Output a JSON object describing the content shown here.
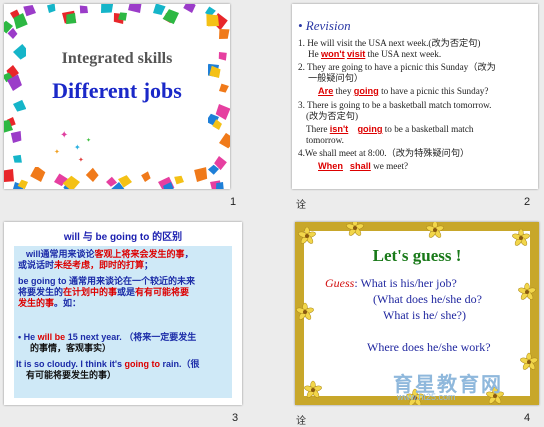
{
  "slide1": {
    "title": "Integrated skills",
    "subtitle": "Different jobs",
    "number": "1"
  },
  "slide2": {
    "heading": "• Revision",
    "l1": "1. He will visit the USA next week.(改为否定句)",
    "l2a": "He ",
    "l2b": "won't",
    "l2c": " ",
    "l2d": "visit",
    "l2e": " the USA next week.",
    "l3": "2. They are going to have a picnic this Sunday（改为",
    "l4": "一般疑问句）",
    "l5a": "Are",
    "l5b": " they ",
    "l5c": "going",
    "l5d": " to have a picnic this Sunday?",
    "l6": "3. There is going to be a basketball match tomorrow.",
    "l7": "(改为否定句)",
    "l8a": "There ",
    "l8b": "isn't",
    "l8c": "going",
    "l8d": " to be a basketball match",
    "l9": "tomorrow.",
    "l10": "4.We shall meet at 8:00.（改为特殊疑问句）",
    "l11a": "When",
    "l11b": "shall",
    "l11c": " we meet?",
    "number": "2",
    "note": "诠"
  },
  "slide3": {
    "heading": "will 与 be going to 的区别",
    "p1a": "will通常用来谈论",
    "p1b": "客观上将来会发生的事",
    "p1c": "，",
    "p1d": "或说话时",
    "p1e": "未经考虑，即时的打算",
    "p1f": "；",
    "p2a": "be going to 通常用来谈论在一个较近的未来",
    "p2b": "将要发生的",
    "p2c": "在计划中的事",
    "p2d": "或是",
    "p2e": "有有可能将要",
    "p2f": "发生的事",
    "p2g": "。如：",
    "ex1a": "• He ",
    "ex1b": "will be",
    "ex1c": " 15 next year. （将来一定要发生",
    "ex1d": "的事情，客观事实）",
    "ex2a": "It is so cloudy. I think it's ",
    "ex2b": "going to",
    "ex2c": " rain.（很",
    "ex2d": "有可能将要发生的事）",
    "number": "3"
  },
  "slide4": {
    "title": "Let's guess !",
    "guess_label": "Guess",
    "q1": ":  What is his/her job?",
    "q2": "(What does he/she do?",
    "q3": "What is he/ she?)",
    "q4": "Where does he/she work?",
    "watermark": "育星教育网",
    "watermark_url": "www.ht25.com",
    "number": "4",
    "note": "诠"
  },
  "colors": {
    "title_blue": "#1a28c8",
    "answer_red": "#d00000",
    "green_title": "#1a7a1a",
    "frame_gold": "#c8a72a"
  }
}
